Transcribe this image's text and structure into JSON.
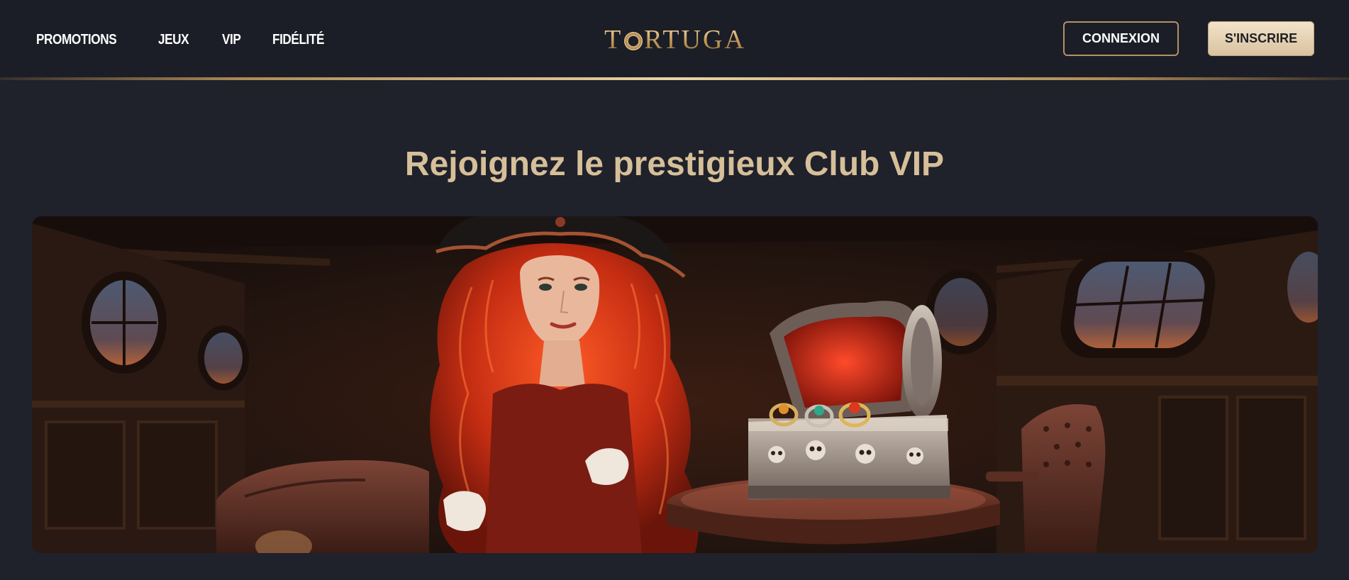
{
  "header": {
    "nav": [
      {
        "label": "PROMOTIONS"
      },
      {
        "label": "JEUX"
      },
      {
        "label": "VIP"
      },
      {
        "label": "FIDÉLITÉ"
      }
    ],
    "logo": {
      "text_before": "T",
      "text_after": "RTUGA"
    },
    "login_label": "CONNEXION",
    "signup_label": "S'INSCRIRE"
  },
  "main": {
    "title": "Rejoignez le prestigieux Club VIP"
  },
  "colors": {
    "background": "#1f212b",
    "header": "#1c1e27",
    "gold": "#d6bf99",
    "accent_gold": "#b39166"
  }
}
